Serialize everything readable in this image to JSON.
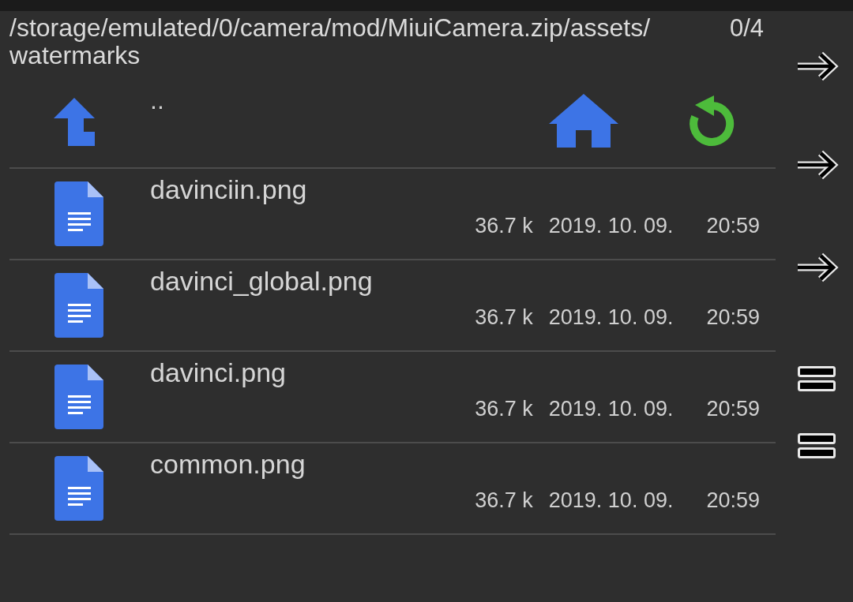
{
  "header": {
    "path": "/storage/emulated/0/camera/mod/MiuiCamera.zip/assets/watermarks",
    "count": "0/4"
  },
  "toolbar": {
    "parent_entry": ".."
  },
  "files": [
    {
      "name": "davinciin.png",
      "size": "36.7 k",
      "date": "2019. 10. 09.",
      "time": "20:59"
    },
    {
      "name": "davinci_global.png",
      "size": "36.7 k",
      "date": "2019. 10. 09.",
      "time": "20:59"
    },
    {
      "name": "davinci.png",
      "size": "36.7 k",
      "date": "2019. 10. 09.",
      "time": "20:59"
    },
    {
      "name": "common.png",
      "size": "36.7 k",
      "date": "2019. 10. 09.",
      "time": "20:59"
    }
  ]
}
